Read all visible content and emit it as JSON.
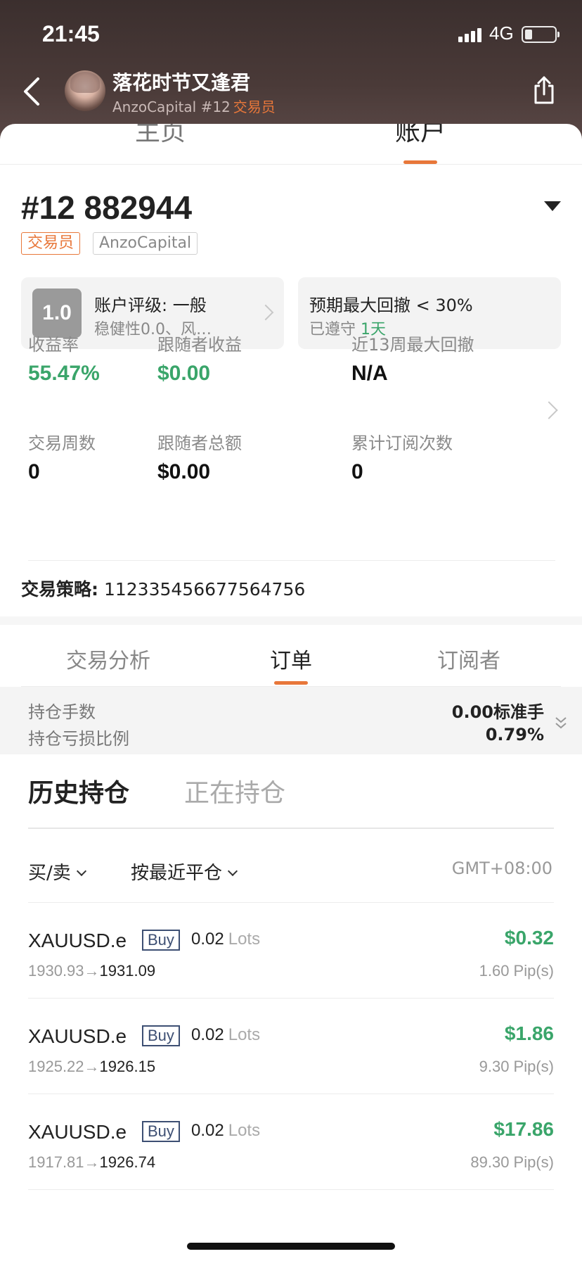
{
  "status_bar": {
    "time": "21:45",
    "network": "4G",
    "battery_level": 0.25
  },
  "header": {
    "name": "落花时节又逢君",
    "broker_line": "AnzoCapital #12",
    "role": "交易员"
  },
  "main_tabs": [
    "主页",
    "账户"
  ],
  "account": {
    "number": "#12 882944",
    "role_tag": "交易员",
    "broker_tag": "AnzoCapital"
  },
  "rating_card": {
    "badge": "1.0",
    "title": "账户评级: 一般",
    "subtitle": "稳健性0.0、风…"
  },
  "drawdown_card": {
    "title": "预期最大回撤 < 30%",
    "subtitle_prefix": "已遵守",
    "subtitle_value": "1天"
  },
  "stats": [
    {
      "label": "收益率",
      "value": "55.47%"
    },
    {
      "label": "跟随者收益",
      "value": "$0.00"
    },
    {
      "label": "近13周最大回撤",
      "value": "N/A"
    },
    {
      "label": "交易周数",
      "value": "0"
    },
    {
      "label": "跟随者总额",
      "value": "$0.00"
    },
    {
      "label": "累计订阅次数",
      "value": "0"
    }
  ],
  "strategy": {
    "label": "交易策略:",
    "value": "112335456677564756"
  },
  "sub_tabs": [
    "交易分析",
    "订单",
    "订阅者"
  ],
  "position_summary": {
    "lots_label": "持仓手数",
    "lots_value": "0.00标准手",
    "pl_label": "持仓亏损比例",
    "pl_value": "0.79%"
  },
  "history_tabs": [
    "历史持仓",
    "正在持仓"
  ],
  "filters": {
    "side": "买/卖",
    "sort": "按最近平仓",
    "timezone": "GMT+08:00"
  },
  "orders": [
    {
      "symbol": "XAUUSD.e",
      "side": "Buy",
      "lots": "0.02",
      "lots_unit": "Lots",
      "open": "1930.93",
      "close": "1931.09",
      "profit": "$0.32",
      "pips": "1.60 Pip(s)"
    },
    {
      "symbol": "XAUUSD.e",
      "side": "Buy",
      "lots": "0.02",
      "lots_unit": "Lots",
      "open": "1925.22",
      "close": "1926.15",
      "profit": "$1.86",
      "pips": "9.30 Pip(s)"
    },
    {
      "symbol": "XAUUSD.e",
      "side": "Buy",
      "lots": "0.02",
      "lots_unit": "Lots",
      "open": "1917.81",
      "close": "1926.74",
      "profit": "$17.86",
      "pips": "89.30 Pip(s)"
    }
  ],
  "colors": {
    "accent": "#e8773a",
    "positive": "#3aa56a",
    "buy_tag": "#3d4f73"
  }
}
